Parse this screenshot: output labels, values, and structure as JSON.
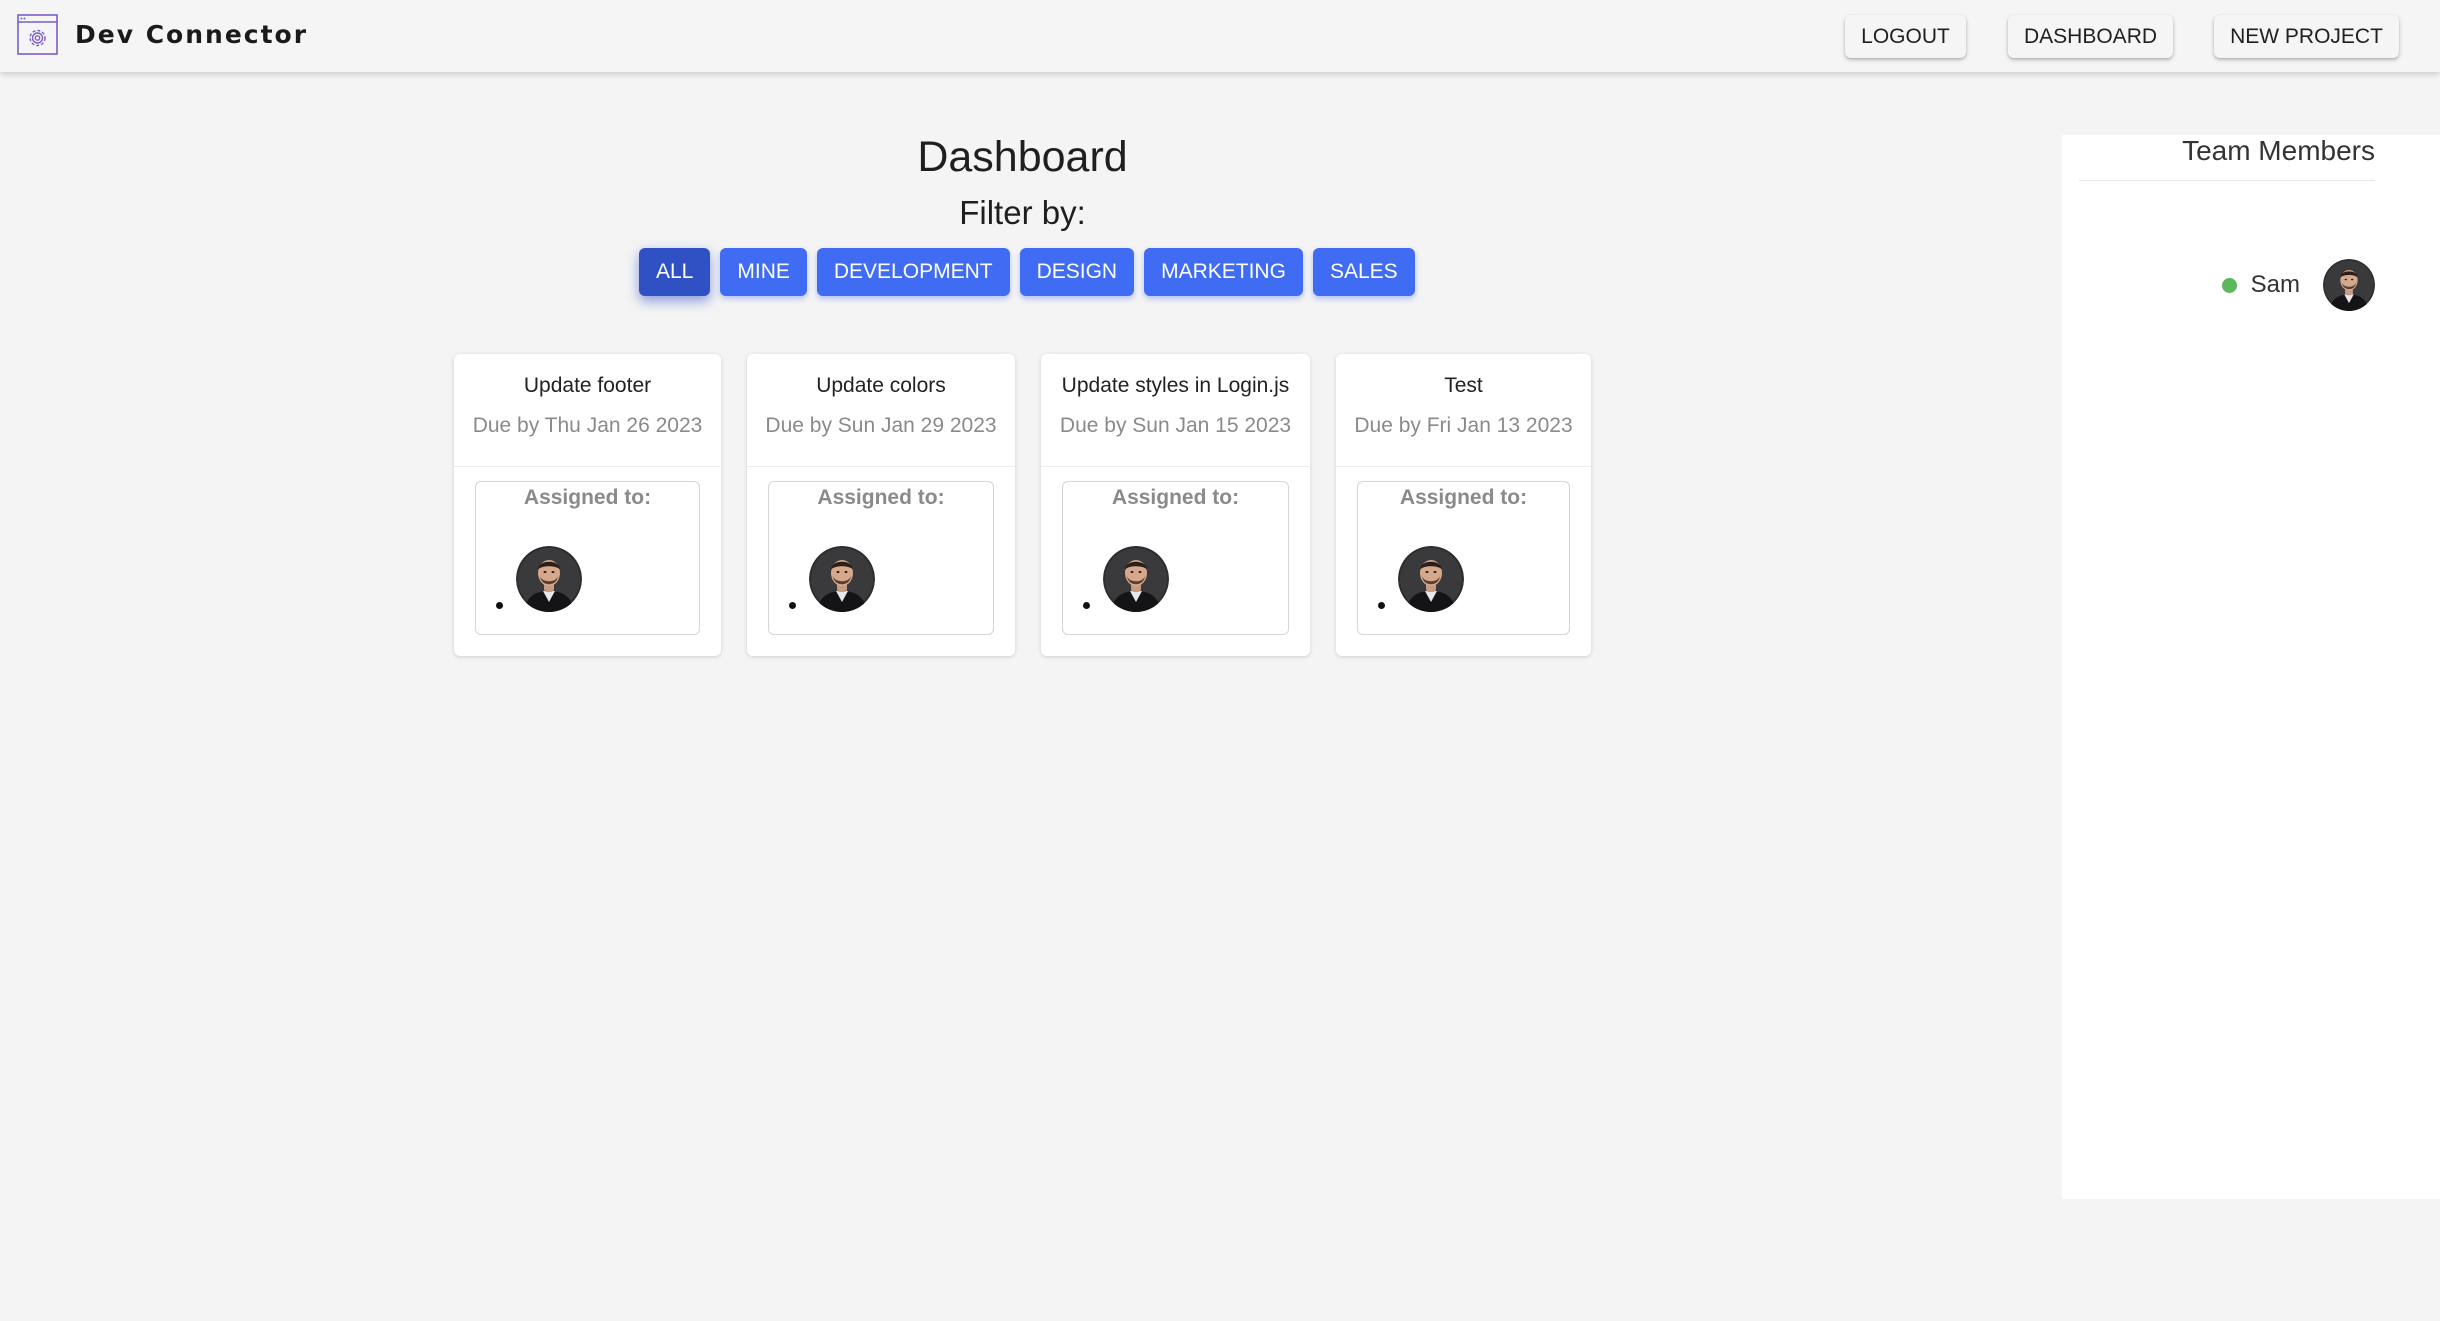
{
  "navbar": {
    "brand_name": "Dev Connector",
    "logo_icon": "settings-window-icon",
    "buttons": {
      "logout": "LOGOUT",
      "dashboard": "DASHBOARD",
      "new_project": "NEW PROJECT"
    }
  },
  "main": {
    "title": "Dashboard",
    "filter_label": "Filter by:",
    "filters": [
      {
        "label": "ALL",
        "active": true
      },
      {
        "label": "MINE",
        "active": false
      },
      {
        "label": "DEVELOPMENT",
        "active": false
      },
      {
        "label": "DESIGN",
        "active": false
      },
      {
        "label": "MARKETING",
        "active": false
      },
      {
        "label": "SALES",
        "active": false
      }
    ],
    "tasks": [
      {
        "title": "Update footer",
        "due": "Due by Thu Jan 26 2023",
        "assigned_label": "Assigned to:"
      },
      {
        "title": "Update colors",
        "due": "Due by Sun Jan 29 2023",
        "assigned_label": "Assigned to:"
      },
      {
        "title": "Update styles in Login.js",
        "due": "Due by Sun Jan 15 2023",
        "assigned_label": "Assigned to:"
      },
      {
        "title": "Test",
        "due": "Due by Fri Jan 13 2023",
        "assigned_label": "Assigned to:"
      }
    ]
  },
  "team": {
    "title": "Team Members",
    "members": [
      {
        "name": "Sam",
        "status": "online"
      }
    ]
  },
  "colors": {
    "primary_button": "#3f6cf2",
    "active_button": "#2f51c4",
    "online": "#5cb85c",
    "logo_purple": "#7b5cc9"
  }
}
